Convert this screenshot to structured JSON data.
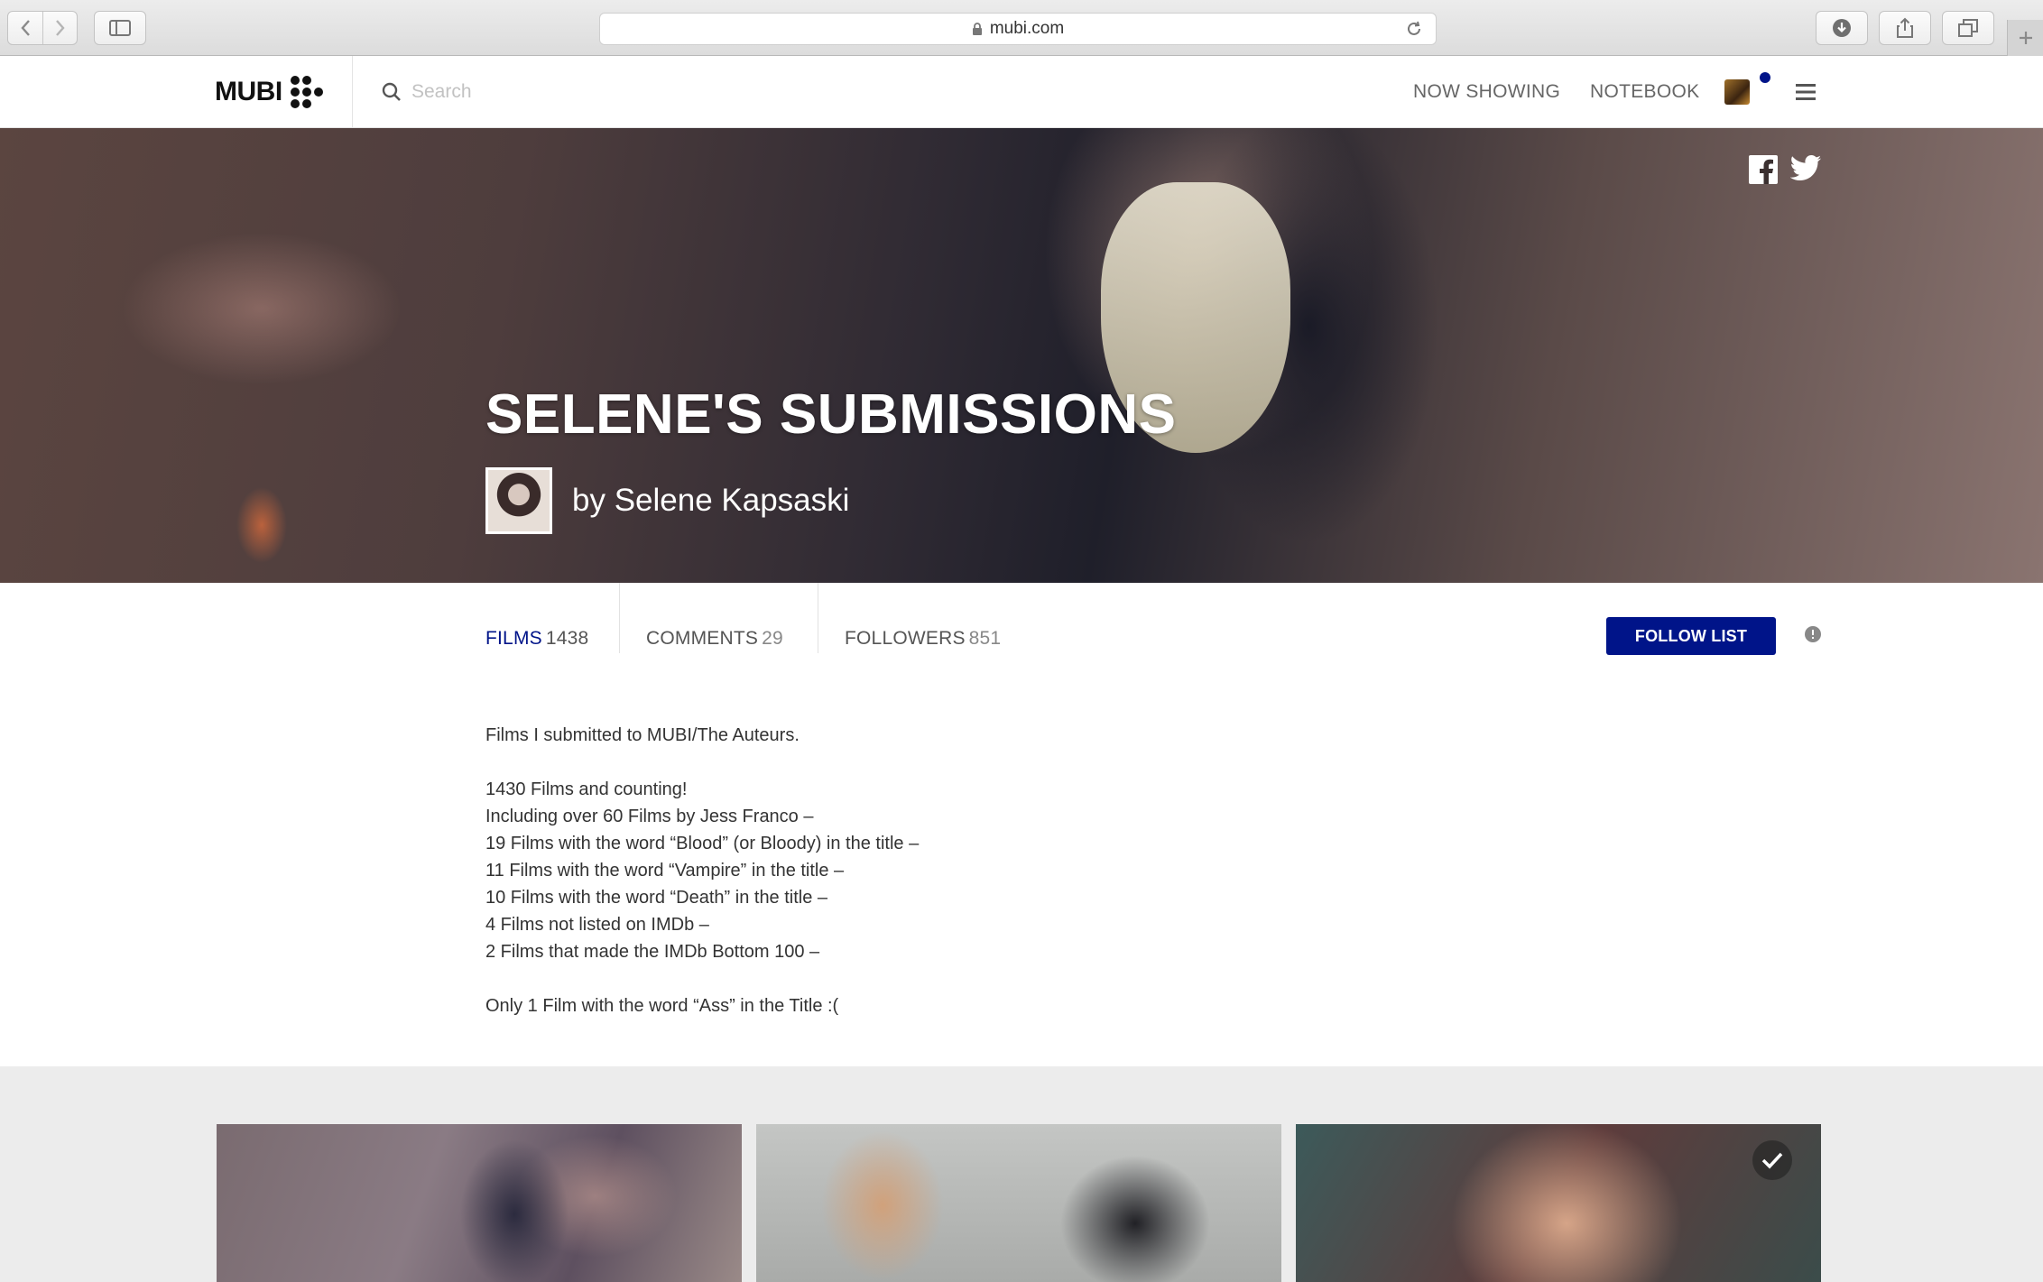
{
  "browser": {
    "url": "mubi.com"
  },
  "header": {
    "logo": "MUBI",
    "search_placeholder": "Search",
    "nav": {
      "now_showing": "NOW SHOWING",
      "notebook": "NOTEBOOK"
    }
  },
  "hero": {
    "title": "SELENE'S SUBMISSIONS",
    "author": "by Selene Kapsaski"
  },
  "tabs": [
    {
      "label": "FILMS",
      "count": "1438"
    },
    {
      "label": "COMMENTS",
      "count": "29"
    },
    {
      "label": "FOLLOWERS",
      "count": "851"
    }
  ],
  "follow_button": "FOLLOW LIST",
  "description": [
    "Films I submitted to MUBI/The Auteurs.",
    "",
    "1430 Films and counting!",
    "Including over 60 Films by Jess Franco –",
    "19 Films with the word “Blood” (or Bloody) in the title –",
    "11 Films with the word “Vampire” in the title –",
    "10 Films with the word “Death” in the title –",
    "4 Films not listed on IMDb –",
    "2 Films that made the IMDb Bottom 100 –",
    "",
    "Only 1 Film with the word “Ass” in the Title :("
  ],
  "colors": {
    "brand": "#001489"
  }
}
